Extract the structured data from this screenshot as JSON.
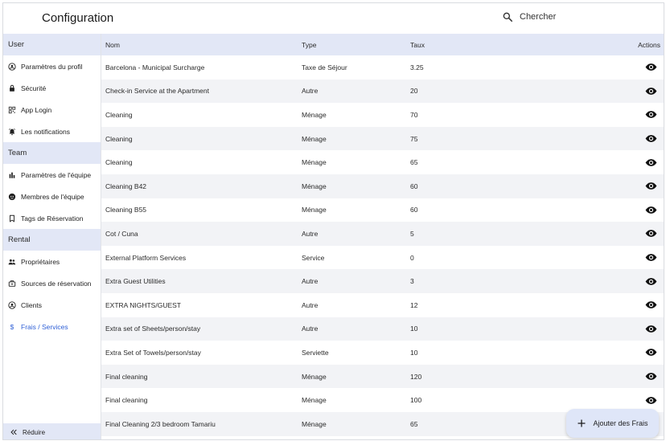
{
  "header": {
    "title": "Configuration",
    "search_placeholder": "Chercher"
  },
  "sidebar": {
    "sections": [
      {
        "title": "User",
        "items": [
          {
            "label": "Paramètres du profil",
            "icon": "account-circle-icon"
          },
          {
            "label": "Sécurité",
            "icon": "lock-icon"
          },
          {
            "label": "App Login",
            "icon": "qr-code-icon"
          },
          {
            "label": "Les notifications",
            "icon": "alarm-icon"
          }
        ]
      },
      {
        "title": "Team",
        "items": [
          {
            "label": "Paramètres de l'équipe",
            "icon": "bar-chart-icon"
          },
          {
            "label": "Membres de l'équipe",
            "icon": "face-icon"
          },
          {
            "label": "Tags de Réservation",
            "icon": "bookmark-icon"
          }
        ]
      },
      {
        "title": "Rental",
        "items": [
          {
            "label": "Propriétaires",
            "icon": "people-icon"
          },
          {
            "label": "Sources de réservation",
            "icon": "source-icon"
          },
          {
            "label": "Clients",
            "icon": "account-circle-icon"
          },
          {
            "label": "Frais / Services",
            "icon": "dollar-icon",
            "active": true
          }
        ]
      }
    ],
    "collapse_label": "Réduire"
  },
  "table": {
    "columns": {
      "name": "Nom",
      "type": "Type",
      "rate": "Taux",
      "actions": "Actions"
    },
    "rows": [
      {
        "name": "Barcelona - Municipal Surcharge",
        "type": "Taxe de Séjour",
        "rate": "3.25"
      },
      {
        "name": "Check-in Service at the Apartment",
        "type": "Autre",
        "rate": "20"
      },
      {
        "name": "Cleaning",
        "type": "Ménage",
        "rate": "70"
      },
      {
        "name": "Cleaning",
        "type": "Ménage",
        "rate": "75"
      },
      {
        "name": "Cleaning",
        "type": "Ménage",
        "rate": "65"
      },
      {
        "name": "Cleaning B42",
        "type": "Ménage",
        "rate": "60"
      },
      {
        "name": "Cleaning B55",
        "type": "Ménage",
        "rate": "60"
      },
      {
        "name": "Cot / Cuna",
        "type": "Autre",
        "rate": "5"
      },
      {
        "name": "External Platform Services",
        "type": "Service",
        "rate": "0"
      },
      {
        "name": "Extra Guest Utilities",
        "type": "Autre",
        "rate": "3"
      },
      {
        "name": "EXTRA NIGHTS/GUEST",
        "type": "Autre",
        "rate": "12"
      },
      {
        "name": "Extra set of Sheets/person/stay",
        "type": "Autre",
        "rate": "10"
      },
      {
        "name": "Extra Set of Towels/person/stay",
        "type": "Serviette",
        "rate": "10"
      },
      {
        "name": "Final cleaning",
        "type": "Ménage",
        "rate": "120"
      },
      {
        "name": "Final cleaning",
        "type": "Ménage",
        "rate": "100"
      },
      {
        "name": "Final Cleaning 2/3 bedroom Tamariu",
        "type": "Ménage",
        "rate": "65"
      }
    ]
  },
  "fab": {
    "label": "Ajouter des Frais",
    "icon": "plus-icon"
  },
  "colors": {
    "accent": "#2e5fd6",
    "section_bg": "#e2e7f6",
    "row_alt": "#f2f3f6"
  }
}
